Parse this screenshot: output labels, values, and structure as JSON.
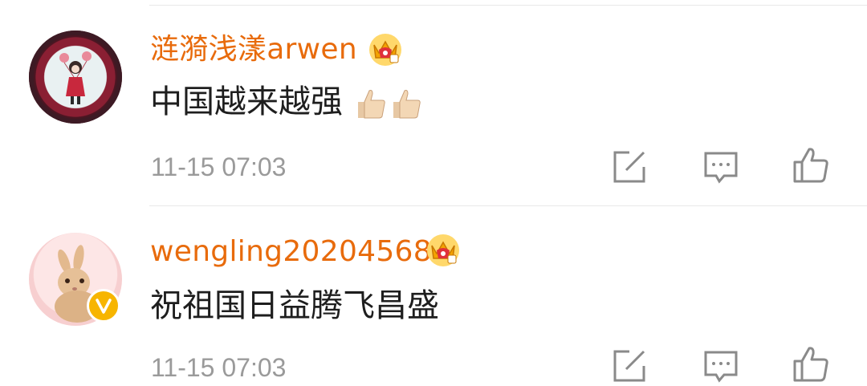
{
  "comments": [
    {
      "username": "涟漪浅漾arwen",
      "content": "中国越来越强",
      "emoji": "thumbs-up-emoji ×2",
      "timestamp": "11-15 07:03",
      "badge": "vip-crown-icon",
      "avatar_verified": false
    },
    {
      "username": "wengling20204568",
      "content": "祝祖国日益腾飞昌盛",
      "timestamp": "11-15 07:03",
      "badge": "vip-crown-icon",
      "avatar_verified": true
    }
  ],
  "actions": [
    "repost-icon",
    "comment-icon",
    "like-icon"
  ],
  "colors": {
    "username": "#e86b0c",
    "timestamp": "#9a9a9a",
    "icon": "#8a8a8a",
    "verified": "#f7b500",
    "divider": "#e8e8e8"
  }
}
